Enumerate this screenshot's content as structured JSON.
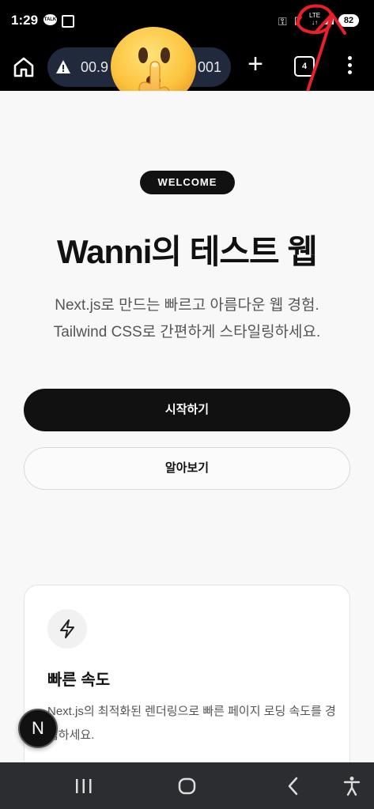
{
  "status_bar": {
    "time": "1:29",
    "talk_label": "TALK",
    "network": "LTE",
    "battery": "82"
  },
  "browser": {
    "url_left": "00.9",
    "url_right": "001",
    "tab_count": "4"
  },
  "page": {
    "badge": "WELCOME",
    "title": "Wanni의 테스트 웹",
    "subtitle_line1": "Next.js로 만드는 빠르고 아름다운 웹 경험.",
    "subtitle_line2": "Tailwind CSS로 간편하게 스타일링하세요.",
    "primary_button": "시작하기",
    "secondary_button": "알아보기",
    "feature_card": {
      "title": "빠른 속도",
      "description": "Next.js의 최적화된 렌더링으로 빠른 페이지 로딩 속도를 경험하세요."
    },
    "fab_label": "N"
  },
  "icons": {
    "home": "home-icon",
    "warning": "warning-icon",
    "plus": "plus-icon",
    "tabs": "tabs-icon",
    "menu": "more-vert-icon",
    "feature": "lightning-icon",
    "nav_recents": "recents-icon",
    "nav_home": "nav-home-icon",
    "nav_back": "back-icon",
    "nav_accessibility": "accessibility-icon"
  },
  "colors": {
    "accent": "#111111",
    "annotation": "#e8202a"
  }
}
